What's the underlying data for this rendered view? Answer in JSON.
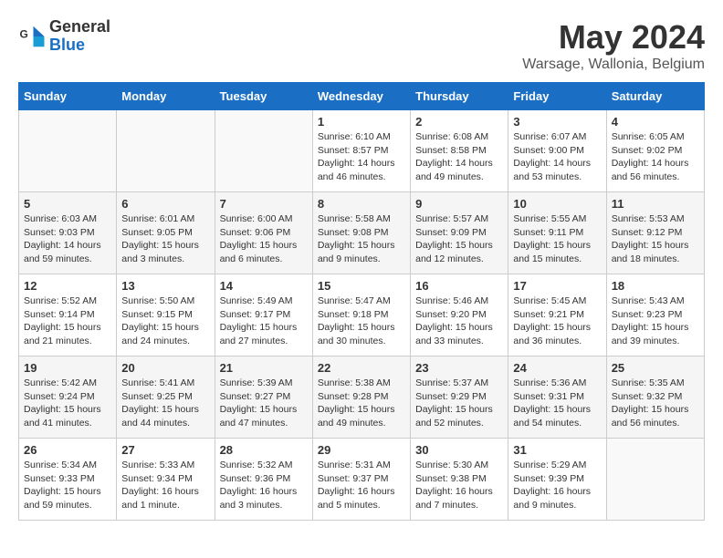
{
  "header": {
    "logo_general": "General",
    "logo_blue": "Blue",
    "month": "May 2024",
    "location": "Warsage, Wallonia, Belgium"
  },
  "days_of_week": [
    "Sunday",
    "Monday",
    "Tuesday",
    "Wednesday",
    "Thursday",
    "Friday",
    "Saturday"
  ],
  "weeks": [
    [
      {
        "day": "",
        "info": ""
      },
      {
        "day": "",
        "info": ""
      },
      {
        "day": "",
        "info": ""
      },
      {
        "day": "1",
        "info": "Sunrise: 6:10 AM\nSunset: 8:57 PM\nDaylight: 14 hours\nand 46 minutes."
      },
      {
        "day": "2",
        "info": "Sunrise: 6:08 AM\nSunset: 8:58 PM\nDaylight: 14 hours\nand 49 minutes."
      },
      {
        "day": "3",
        "info": "Sunrise: 6:07 AM\nSunset: 9:00 PM\nDaylight: 14 hours\nand 53 minutes."
      },
      {
        "day": "4",
        "info": "Sunrise: 6:05 AM\nSunset: 9:02 PM\nDaylight: 14 hours\nand 56 minutes."
      }
    ],
    [
      {
        "day": "5",
        "info": "Sunrise: 6:03 AM\nSunset: 9:03 PM\nDaylight: 14 hours\nand 59 minutes."
      },
      {
        "day": "6",
        "info": "Sunrise: 6:01 AM\nSunset: 9:05 PM\nDaylight: 15 hours\nand 3 minutes."
      },
      {
        "day": "7",
        "info": "Sunrise: 6:00 AM\nSunset: 9:06 PM\nDaylight: 15 hours\nand 6 minutes."
      },
      {
        "day": "8",
        "info": "Sunrise: 5:58 AM\nSunset: 9:08 PM\nDaylight: 15 hours\nand 9 minutes."
      },
      {
        "day": "9",
        "info": "Sunrise: 5:57 AM\nSunset: 9:09 PM\nDaylight: 15 hours\nand 12 minutes."
      },
      {
        "day": "10",
        "info": "Sunrise: 5:55 AM\nSunset: 9:11 PM\nDaylight: 15 hours\nand 15 minutes."
      },
      {
        "day": "11",
        "info": "Sunrise: 5:53 AM\nSunset: 9:12 PM\nDaylight: 15 hours\nand 18 minutes."
      }
    ],
    [
      {
        "day": "12",
        "info": "Sunrise: 5:52 AM\nSunset: 9:14 PM\nDaylight: 15 hours\nand 21 minutes."
      },
      {
        "day": "13",
        "info": "Sunrise: 5:50 AM\nSunset: 9:15 PM\nDaylight: 15 hours\nand 24 minutes."
      },
      {
        "day": "14",
        "info": "Sunrise: 5:49 AM\nSunset: 9:17 PM\nDaylight: 15 hours\nand 27 minutes."
      },
      {
        "day": "15",
        "info": "Sunrise: 5:47 AM\nSunset: 9:18 PM\nDaylight: 15 hours\nand 30 minutes."
      },
      {
        "day": "16",
        "info": "Sunrise: 5:46 AM\nSunset: 9:20 PM\nDaylight: 15 hours\nand 33 minutes."
      },
      {
        "day": "17",
        "info": "Sunrise: 5:45 AM\nSunset: 9:21 PM\nDaylight: 15 hours\nand 36 minutes."
      },
      {
        "day": "18",
        "info": "Sunrise: 5:43 AM\nSunset: 9:23 PM\nDaylight: 15 hours\nand 39 minutes."
      }
    ],
    [
      {
        "day": "19",
        "info": "Sunrise: 5:42 AM\nSunset: 9:24 PM\nDaylight: 15 hours\nand 41 minutes."
      },
      {
        "day": "20",
        "info": "Sunrise: 5:41 AM\nSunset: 9:25 PM\nDaylight: 15 hours\nand 44 minutes."
      },
      {
        "day": "21",
        "info": "Sunrise: 5:39 AM\nSunset: 9:27 PM\nDaylight: 15 hours\nand 47 minutes."
      },
      {
        "day": "22",
        "info": "Sunrise: 5:38 AM\nSunset: 9:28 PM\nDaylight: 15 hours\nand 49 minutes."
      },
      {
        "day": "23",
        "info": "Sunrise: 5:37 AM\nSunset: 9:29 PM\nDaylight: 15 hours\nand 52 minutes."
      },
      {
        "day": "24",
        "info": "Sunrise: 5:36 AM\nSunset: 9:31 PM\nDaylight: 15 hours\nand 54 minutes."
      },
      {
        "day": "25",
        "info": "Sunrise: 5:35 AM\nSunset: 9:32 PM\nDaylight: 15 hours\nand 56 minutes."
      }
    ],
    [
      {
        "day": "26",
        "info": "Sunrise: 5:34 AM\nSunset: 9:33 PM\nDaylight: 15 hours\nand 59 minutes."
      },
      {
        "day": "27",
        "info": "Sunrise: 5:33 AM\nSunset: 9:34 PM\nDaylight: 16 hours\nand 1 minute."
      },
      {
        "day": "28",
        "info": "Sunrise: 5:32 AM\nSunset: 9:36 PM\nDaylight: 16 hours\nand 3 minutes."
      },
      {
        "day": "29",
        "info": "Sunrise: 5:31 AM\nSunset: 9:37 PM\nDaylight: 16 hours\nand 5 minutes."
      },
      {
        "day": "30",
        "info": "Sunrise: 5:30 AM\nSunset: 9:38 PM\nDaylight: 16 hours\nand 7 minutes."
      },
      {
        "day": "31",
        "info": "Sunrise: 5:29 AM\nSunset: 9:39 PM\nDaylight: 16 hours\nand 9 minutes."
      },
      {
        "day": "",
        "info": ""
      }
    ]
  ]
}
